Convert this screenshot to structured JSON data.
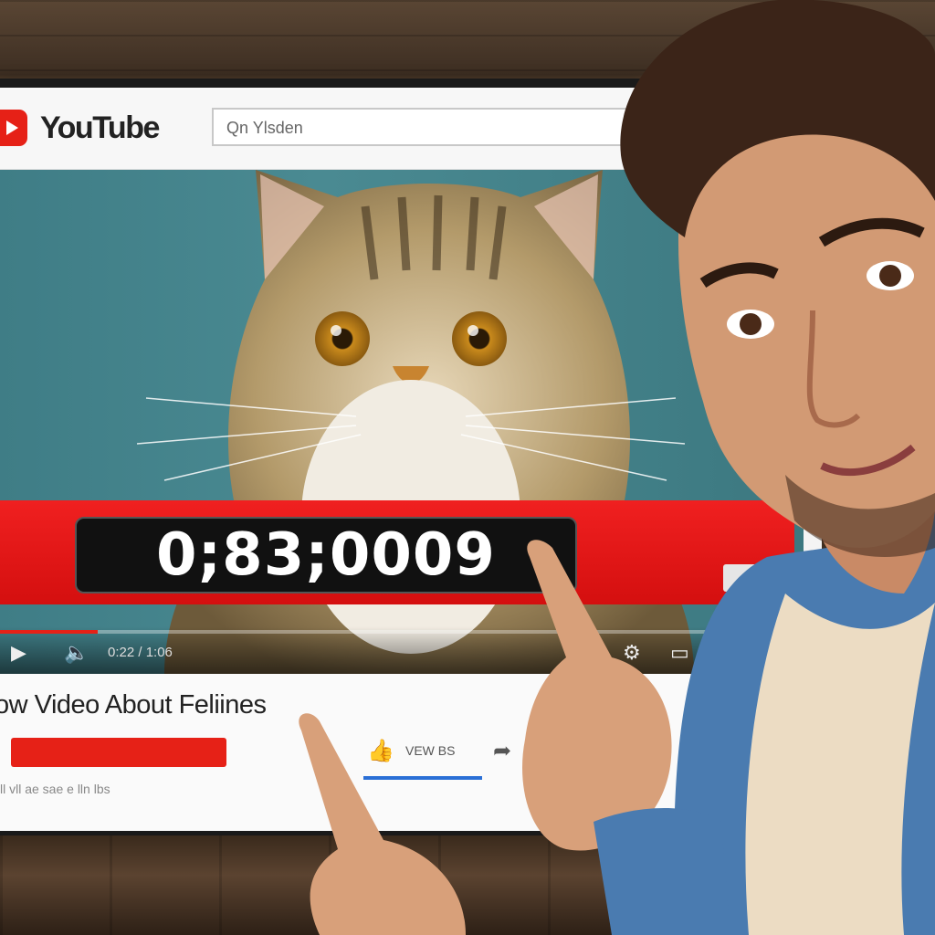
{
  "topbar": {
    "logo_text": "YouTube",
    "search_value": "Qn Ylsden"
  },
  "player": {
    "overlay_timestamp": "0;83;0009",
    "current_time": "0:22 / 1:06",
    "progress_fraction": 0.13,
    "accent_color": "#e62117"
  },
  "info": {
    "title": "ow Video About Feliines",
    "subscribe_label": "",
    "views_label": "VEW BS",
    "meta_text": "ll vll ae sae e lln lbs"
  },
  "icons": [
    "youtube-play-icon",
    "play-icon",
    "volume-icon",
    "settings-icon",
    "fullscreen-icon",
    "like-icon",
    "share-icon"
  ]
}
